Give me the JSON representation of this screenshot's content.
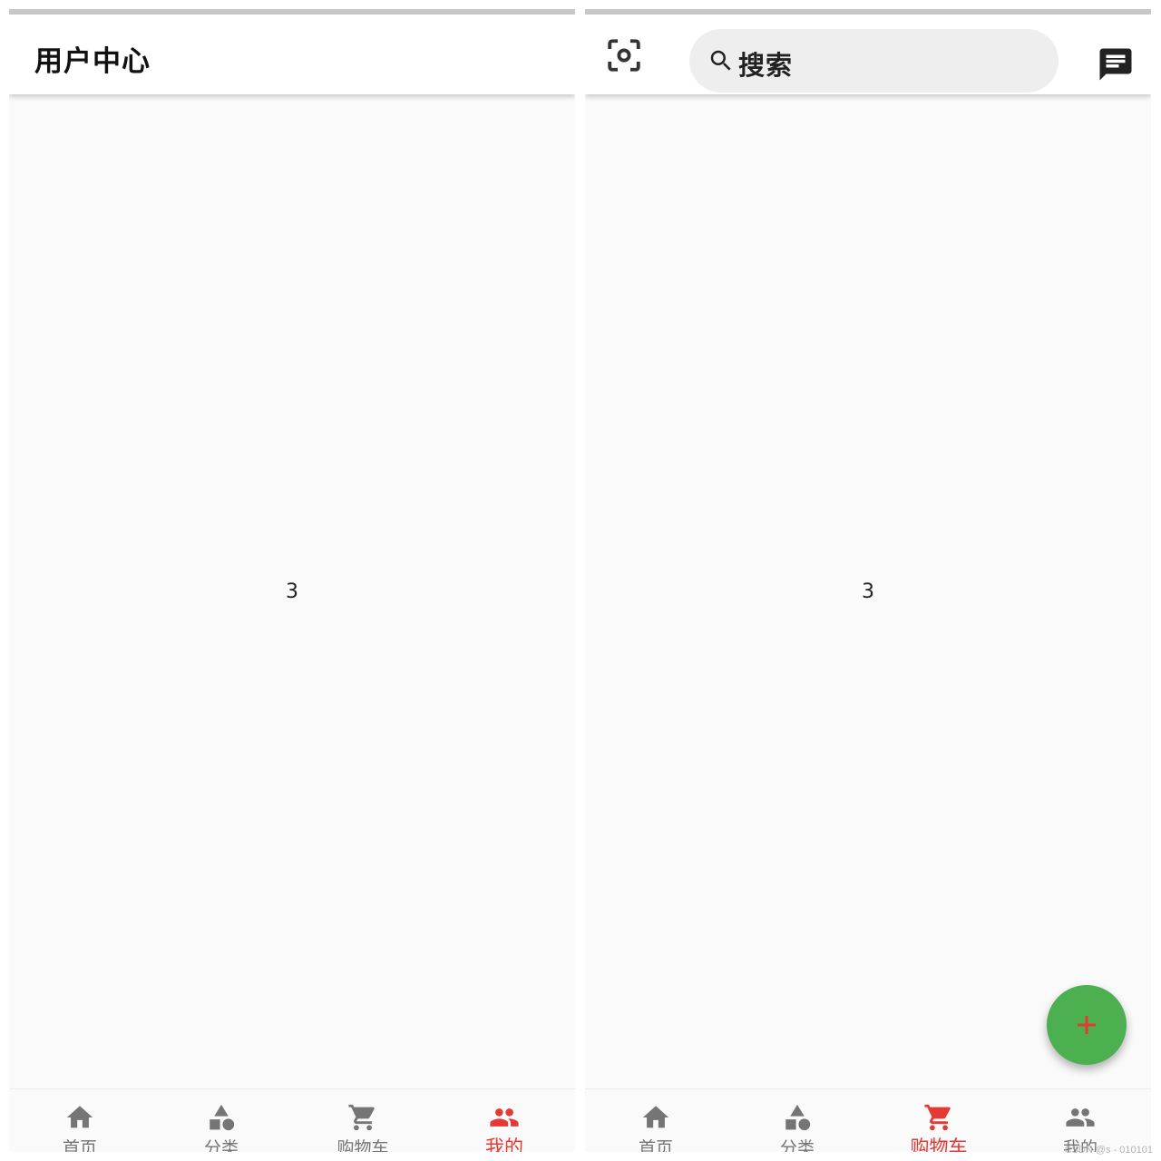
{
  "colors": {
    "active": "#e53935",
    "inactive": "#757575",
    "fab": "#4caf50",
    "fab_icon": "#e53935",
    "search_bg": "#eeeeee"
  },
  "screens": [
    {
      "appbar": {
        "title": "用户中心"
      },
      "body_text": "3",
      "bottom_nav": [
        {
          "label": "首页",
          "icon": "home-icon",
          "active": false
        },
        {
          "label": "分类",
          "icon": "category-icon",
          "active": false
        },
        {
          "label": "购物车",
          "icon": "cart-icon",
          "active": false
        },
        {
          "label": "我的",
          "icon": "people-icon",
          "active": true
        }
      ]
    },
    {
      "appbar": {
        "scan_icon": "scan-icon",
        "search_placeholder": "搜索",
        "message_icon": "message-icon"
      },
      "body_text": "3",
      "fab": {
        "icon": "add-icon"
      },
      "bottom_nav": [
        {
          "label": "首页",
          "icon": "home-icon",
          "active": false
        },
        {
          "label": "分类",
          "icon": "category-icon",
          "active": false
        },
        {
          "label": "购物车",
          "icon": "cart-icon",
          "active": true
        },
        {
          "label": "我的",
          "icon": "people-icon",
          "active": false
        }
      ]
    }
  ],
  "watermark": "CSDN @s - 010101"
}
